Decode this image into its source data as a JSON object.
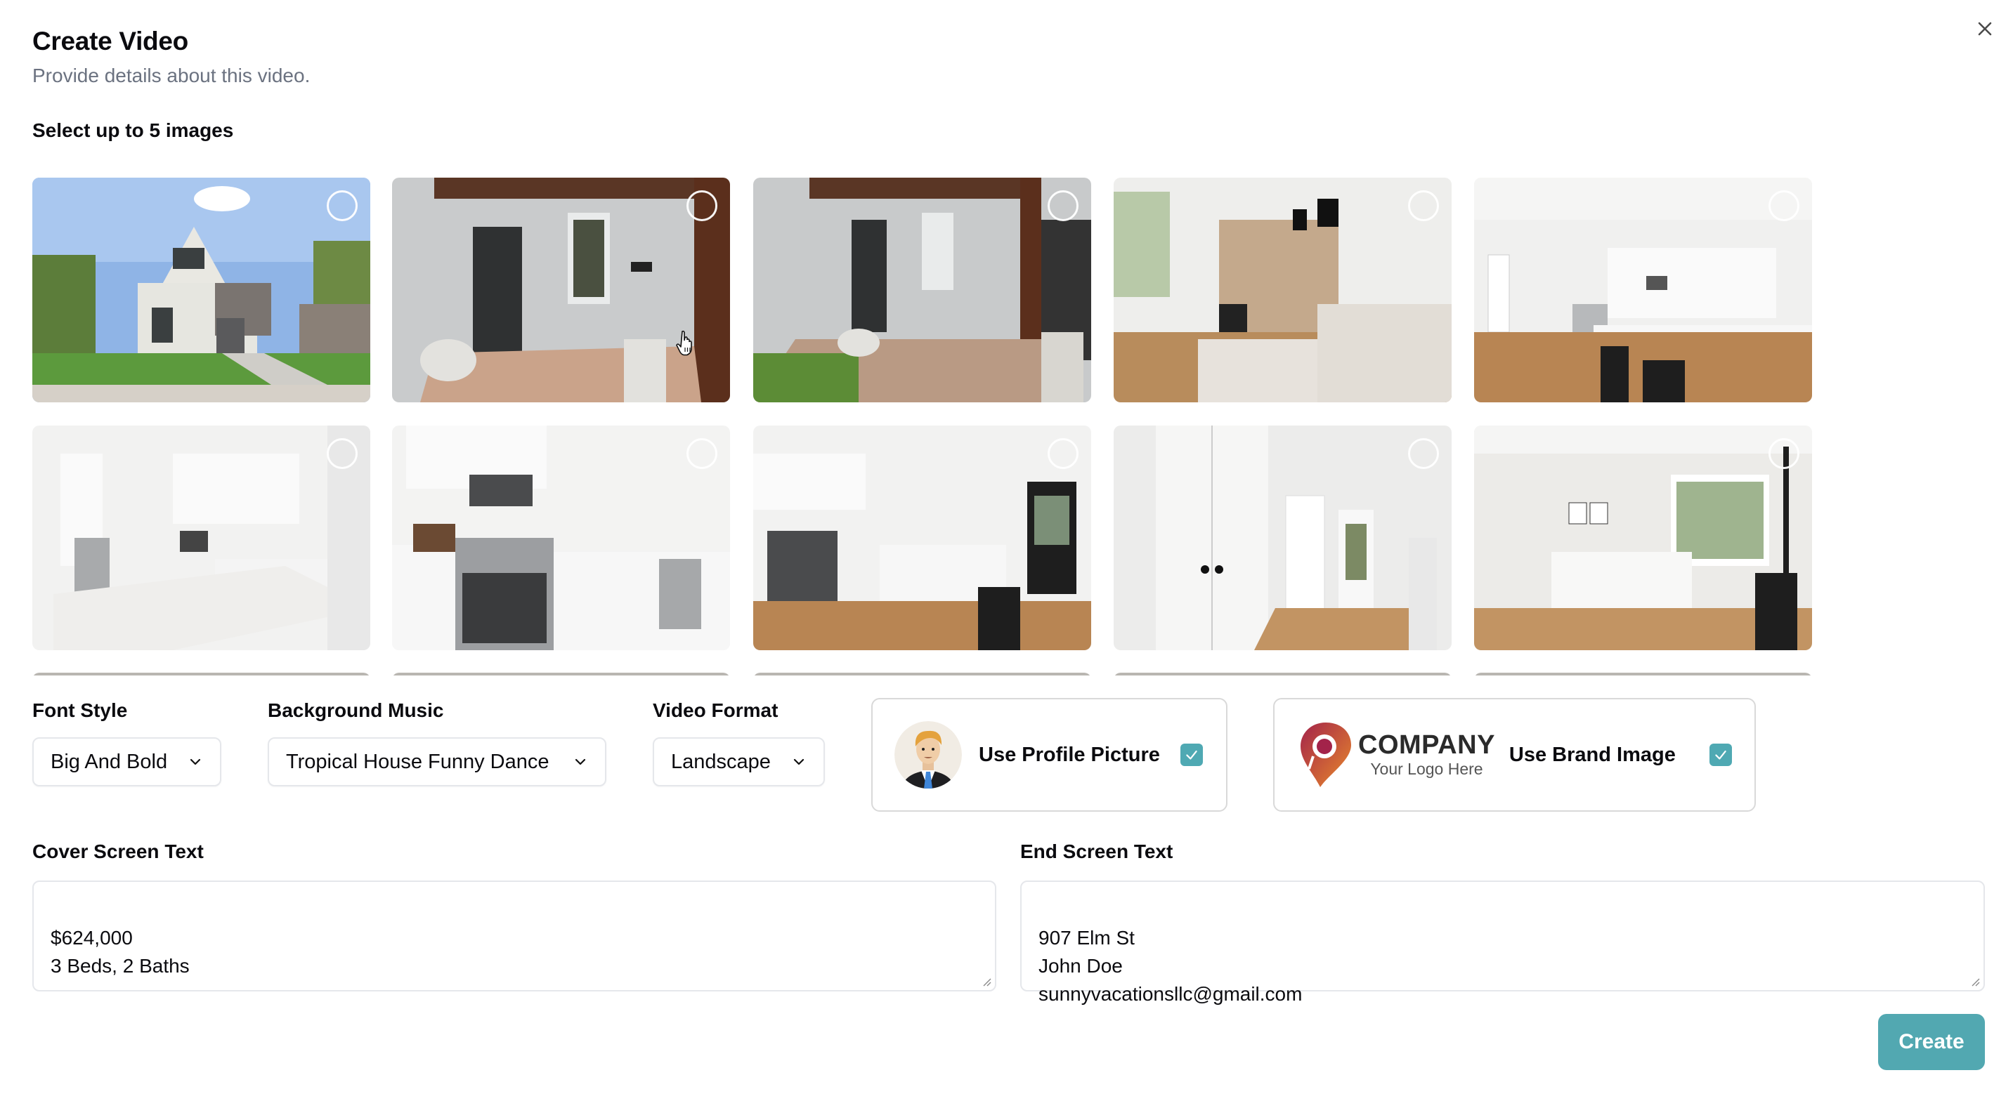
{
  "dialog": {
    "title": "Create Video",
    "subtitle": "Provide details about this video.",
    "close_icon": "close-icon"
  },
  "images": {
    "label": "Select up to 5 images",
    "max_selection": 5,
    "selected_count": 0,
    "items": [
      {
        "scene": "house-exterior",
        "selected": false
      },
      {
        "scene": "front-porch-door",
        "selected": false
      },
      {
        "scene": "front-porch-wide",
        "selected": false
      },
      {
        "scene": "living-room-brick-wall",
        "selected": false
      },
      {
        "scene": "kitchen-hallway",
        "selected": false
      },
      {
        "scene": "kitchen-island",
        "selected": false
      },
      {
        "scene": "kitchen-range",
        "selected": false
      },
      {
        "scene": "kitchen-island-door",
        "selected": false
      },
      {
        "scene": "hallway-double-doors",
        "selected": false
      },
      {
        "scene": "bedroom",
        "selected": false
      },
      {
        "scene": "partial",
        "selected": false
      },
      {
        "scene": "partial",
        "selected": false
      },
      {
        "scene": "partial",
        "selected": false
      },
      {
        "scene": "partial",
        "selected": false
      },
      {
        "scene": "partial",
        "selected": false
      }
    ]
  },
  "font_style": {
    "label": "Font Style",
    "value": "Big And Bold"
  },
  "background_music": {
    "label": "Background Music",
    "value": "Tropical House Funny Dance"
  },
  "video_format": {
    "label": "Video Format",
    "value": "Landscape"
  },
  "profile_picture": {
    "label": "Use Profile Picture",
    "checked": true
  },
  "brand_image": {
    "label": "Use Brand Image",
    "checked": true,
    "logo_name": "COMPANY",
    "logo_tagline": "Your Logo Here"
  },
  "cover_screen": {
    "label": "Cover Screen Text",
    "value": "$624,000\n3 Beds, 2 Baths"
  },
  "end_screen": {
    "label": "End Screen Text",
    "value": "907 Elm St\nJohn Doe\nsunnyvacationsllc@gmail.com"
  },
  "actions": {
    "create_label": "Create"
  },
  "colors": {
    "accent": "#52a8b1",
    "subtitle": "#6b7280",
    "border": "#e5e7eb"
  }
}
